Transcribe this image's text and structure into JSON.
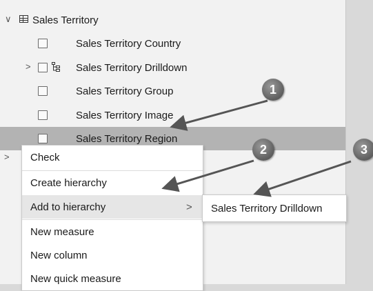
{
  "fields_pane": {
    "table_name": "Sales Territory",
    "fields": [
      {
        "label": "Sales Territory Country"
      },
      {
        "label": "Sales Territory Drilldown"
      },
      {
        "label": "Sales Territory Group"
      },
      {
        "label": "Sales Territory Image"
      },
      {
        "label": "Sales Territory Region"
      }
    ]
  },
  "context_menu": {
    "items": [
      {
        "label": "Check"
      },
      {
        "label": "Create hierarchy"
      },
      {
        "label": "Add to hierarchy",
        "arrow": ">"
      },
      {
        "label": "New measure"
      },
      {
        "label": "New column"
      },
      {
        "label": "New quick measure"
      }
    ]
  },
  "submenu": {
    "items": [
      {
        "label": "Sales Territory Drilldown"
      }
    ]
  },
  "callouts": [
    "1",
    "2",
    "3"
  ],
  "icons": {
    "expand_open": "∨",
    "expand_closed": ">",
    "table": "table-icon",
    "hierarchy": "hierarchy-icon"
  },
  "colors": {
    "selected_row": "#b3b3b3",
    "menu_hover": "#e6e6e6",
    "callout": "#6e6e6e"
  }
}
